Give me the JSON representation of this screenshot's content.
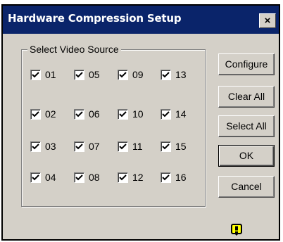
{
  "window": {
    "title": "Hardware Compression Setup",
    "close_glyph": "×"
  },
  "group": {
    "legend": "Select Video Source",
    "channels": [
      {
        "label": "01",
        "checked": true
      },
      {
        "label": "05",
        "checked": true
      },
      {
        "label": "09",
        "checked": true
      },
      {
        "label": "13",
        "checked": true
      },
      {
        "label": "02",
        "checked": true
      },
      {
        "label": "06",
        "checked": true
      },
      {
        "label": "10",
        "checked": true
      },
      {
        "label": "14",
        "checked": true
      },
      {
        "label": "03",
        "checked": true
      },
      {
        "label": "07",
        "checked": true
      },
      {
        "label": "11",
        "checked": true
      },
      {
        "label": "15",
        "checked": true
      },
      {
        "label": "04",
        "checked": true
      },
      {
        "label": "08",
        "checked": true
      },
      {
        "label": "12",
        "checked": true
      },
      {
        "label": "16",
        "checked": true
      }
    ]
  },
  "buttons": {
    "configure": "Configure",
    "clear_all": "Clear All",
    "select_all": "Select All",
    "ok": "OK",
    "cancel": "Cancel"
  },
  "status_icon": {
    "name": "warning-icon",
    "color": "#ffff00"
  },
  "colors": {
    "titlebar": "#0a246a",
    "face": "#d4d0c8"
  }
}
